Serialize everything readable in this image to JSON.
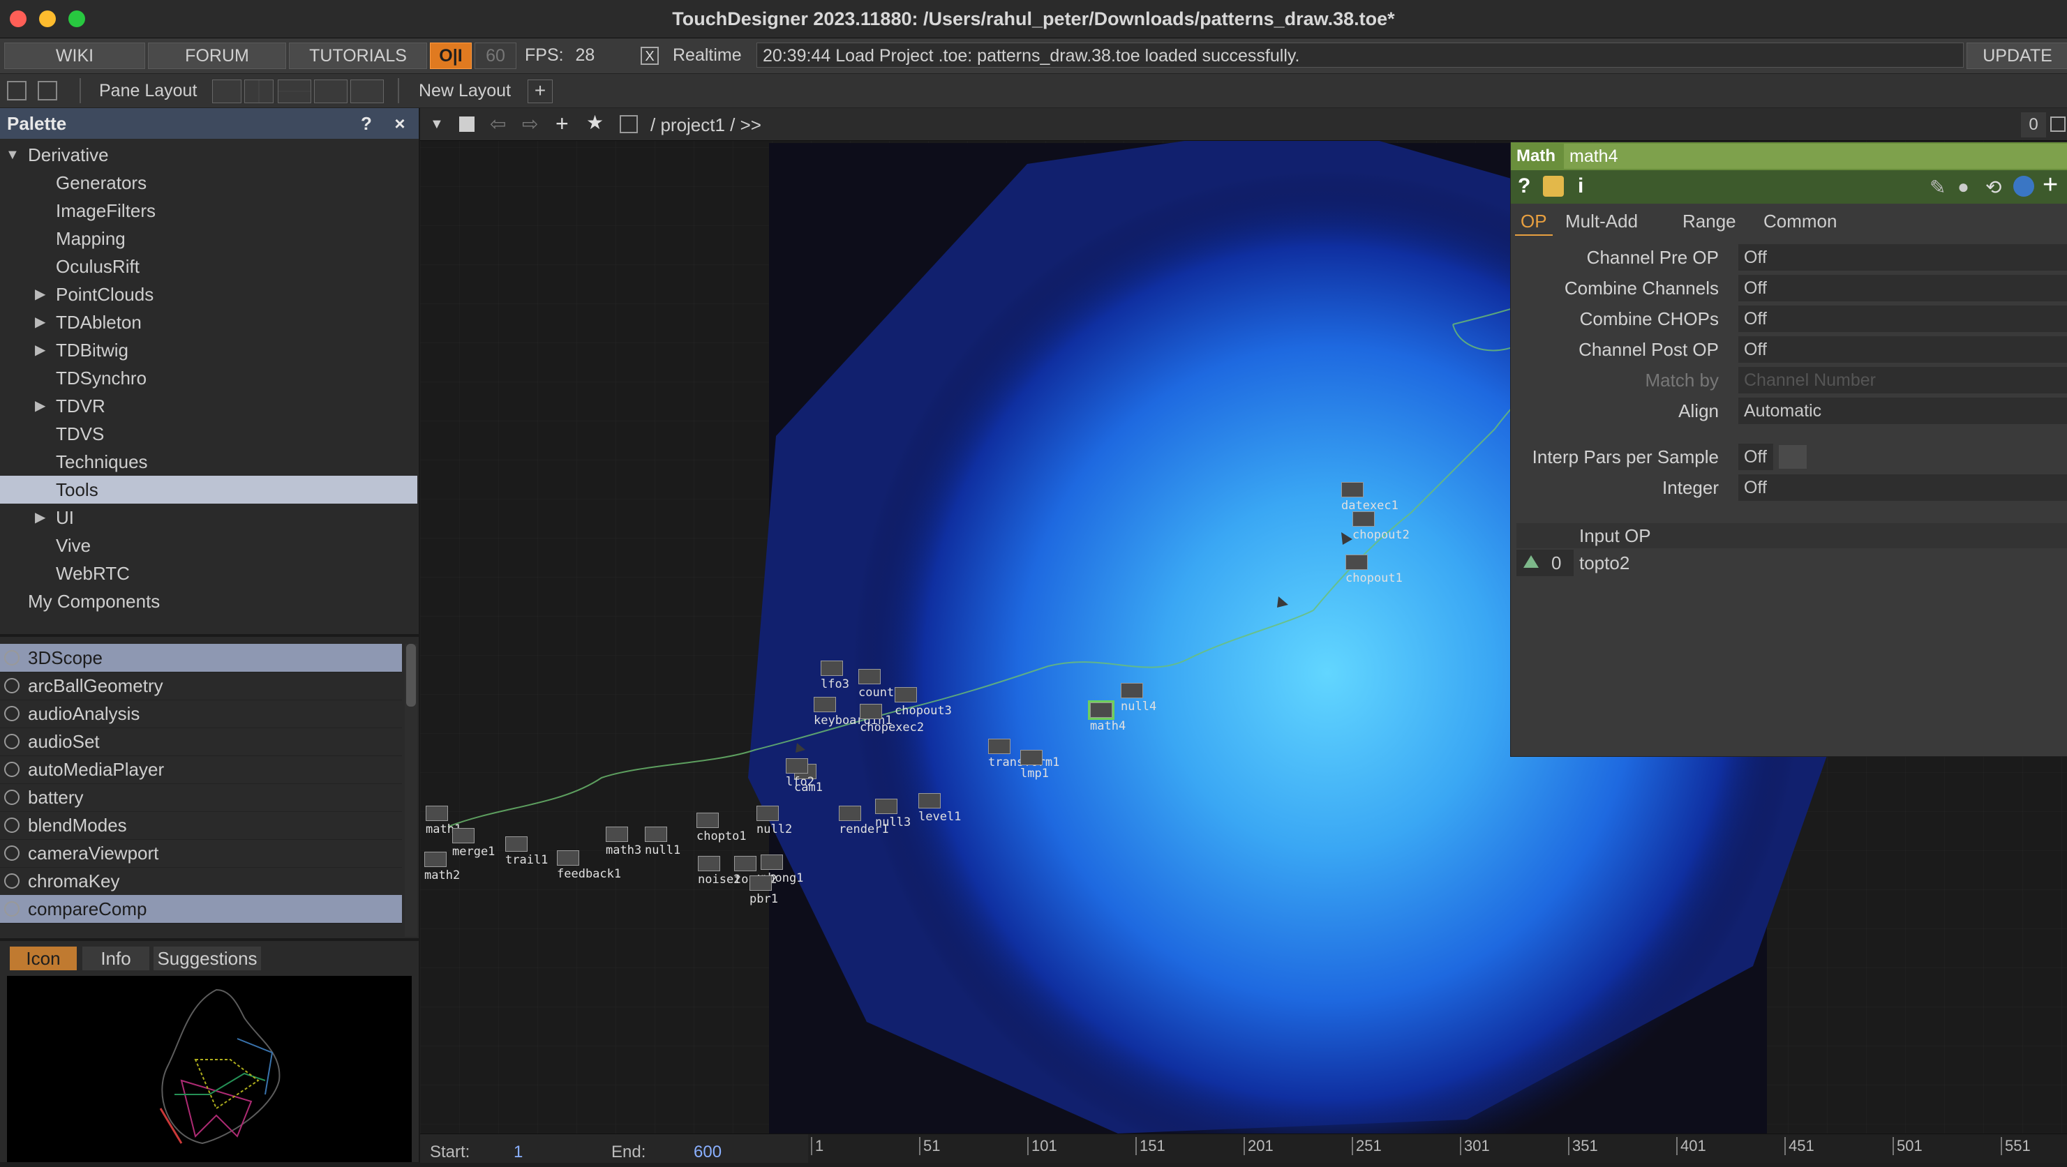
{
  "window": {
    "title": "TouchDesigner 2023.11880: /Users/rahul_peter/Downloads/patterns_draw.38.toe*"
  },
  "colors": {
    "accent": "#ff8c00",
    "palette_header": "#3e4a5e",
    "math_header": "#6a8f3c",
    "selected": "#bcc3d3"
  },
  "topbar": {
    "wiki": "WIKI",
    "forum": "FORUM",
    "tutorials": "TUTORIALS",
    "oi": "O|I",
    "fps_target": "60",
    "fps_label": "FPS:",
    "fps_value": "28",
    "realtime_check": "X",
    "realtime": "Realtime",
    "status": "20:39:44 Load Project .toe: patterns_draw.38.toe loaded successfully.",
    "update": "UPDATE"
  },
  "panebar": {
    "pane_layout": "Pane Layout",
    "new_layout": "New Layout",
    "add": "+"
  },
  "palette": {
    "title": "Palette",
    "help": "?",
    "close": "×",
    "root": "Derivative",
    "items": [
      {
        "label": "Generators",
        "expandable": false
      },
      {
        "label": "ImageFilters",
        "expandable": false
      },
      {
        "label": "Mapping",
        "expandable": false
      },
      {
        "label": "OculusRift",
        "expandable": false
      },
      {
        "label": "PointClouds",
        "expandable": true
      },
      {
        "label": "TDAbleton",
        "expandable": true
      },
      {
        "label": "TDBitwig",
        "expandable": true
      },
      {
        "label": "TDSynchro",
        "expandable": false
      },
      {
        "label": "TDVR",
        "expandable": true
      },
      {
        "label": "TDVS",
        "expandable": false
      },
      {
        "label": "Techniques",
        "expandable": false
      },
      {
        "label": "Tools",
        "expandable": false
      },
      {
        "label": "UI",
        "expandable": true
      },
      {
        "label": "Vive",
        "expandable": false
      },
      {
        "label": "WebRTC",
        "expandable": false
      }
    ],
    "my_components": "My Components",
    "components": [
      "3DScope",
      "arcBallGeometry",
      "audioAnalysis",
      "audioSet",
      "autoMediaPlayer",
      "battery",
      "blendModes",
      "cameraViewport",
      "chromaKey",
      "compareComp"
    ],
    "tabs": {
      "icon": "Icon",
      "info": "Info",
      "suggestions": "Suggestions"
    }
  },
  "network": {
    "path": "/ project1 / >>",
    "right_value": "0",
    "nodes": [
      "math1",
      "merge1",
      "trail1",
      "feedback1",
      "math3",
      "null1",
      "chopto1",
      "null2",
      "cam1",
      "lfo2",
      "render1",
      "null3",
      "level1",
      "noise2",
      "topto2",
      "phong1",
      "pbr1",
      "math2",
      "keyboardin1",
      "count1",
      "lfo3",
      "chopexec2",
      "chopout3",
      "transform1",
      "lmp1",
      "datexec1",
      "chopout2",
      "chopout1",
      "null4",
      "math4"
    ]
  },
  "params": {
    "op_type": "Math",
    "op_name": "math4",
    "tabs": [
      "OP",
      "Mult-Add",
      "Range",
      "Common"
    ],
    "rows": [
      {
        "label": "Channel Pre OP",
        "value": "Off"
      },
      {
        "label": "Combine Channels",
        "value": "Off"
      },
      {
        "label": "Combine CHOPs",
        "value": "Off"
      },
      {
        "label": "Channel Post OP",
        "value": "Off"
      },
      {
        "label": "Match by",
        "value": "Channel Number"
      },
      {
        "label": "Align",
        "value": "Automatic"
      },
      {
        "label": "Interp Pars per Sample",
        "value": "Off"
      },
      {
        "label": "Integer",
        "value": "Off"
      }
    ],
    "input_header": "Input OP",
    "input_index": "0",
    "input_value": "topto2"
  },
  "timeline": {
    "start_label": "Start:",
    "start_value": "1",
    "end_label": "End:",
    "end_value": "600",
    "ticks": [
      "1",
      "51",
      "101",
      "151",
      "201",
      "251",
      "301",
      "351",
      "401",
      "451",
      "501",
      "551"
    ]
  }
}
